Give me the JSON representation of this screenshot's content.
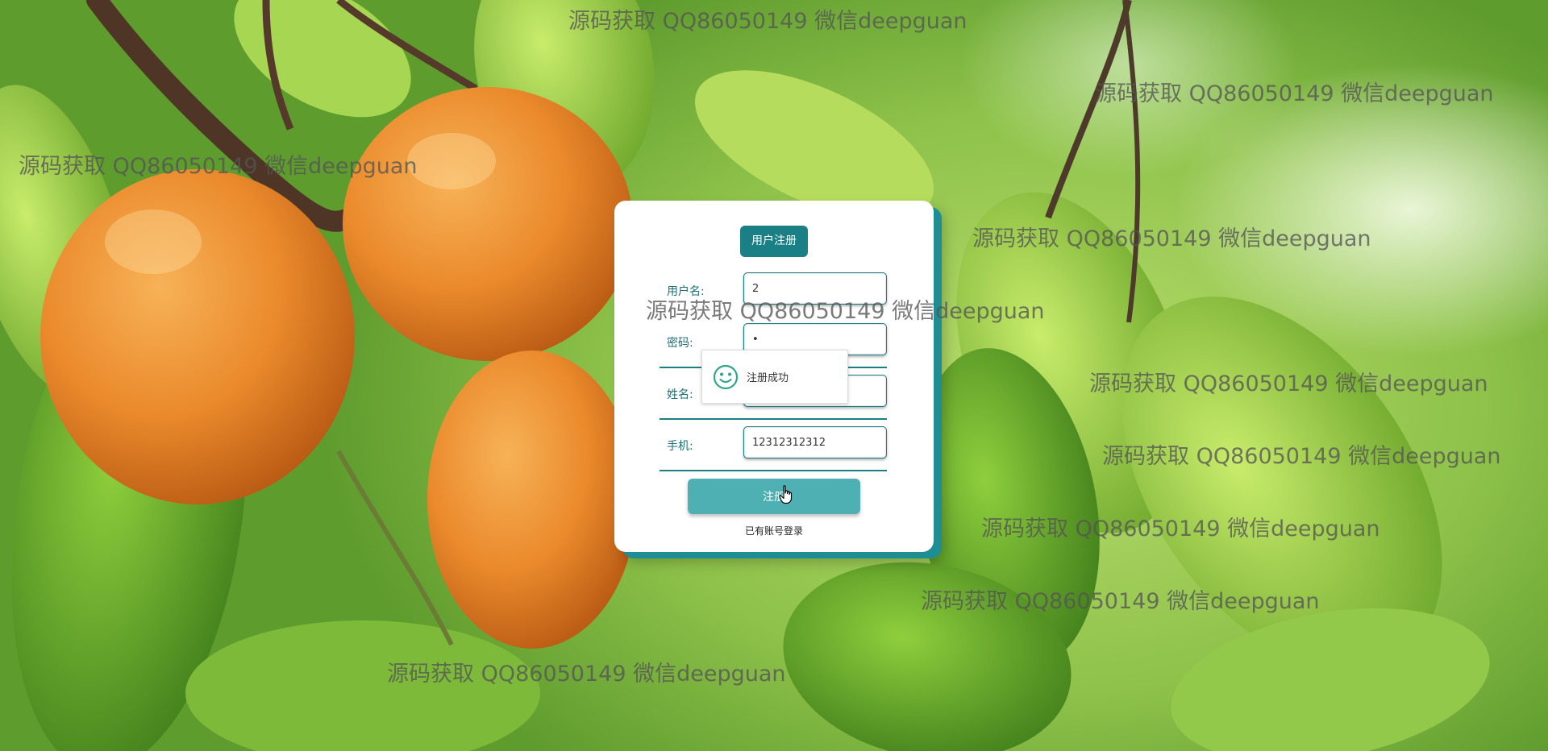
{
  "form": {
    "title": "用户注册",
    "fields": [
      {
        "label": "用户名:",
        "value": "2"
      },
      {
        "label": "密码:",
        "value": "•"
      },
      {
        "label": "姓名:",
        "value": ""
      },
      {
        "label": "手机:",
        "value": "12312312312"
      }
    ],
    "submit_label": "注册",
    "login_link": "已有账号登录"
  },
  "toast": {
    "message": "注册成功",
    "icon": "smiley-icon"
  },
  "watermark_text": "源码获取 QQ86050149 微信deepguan",
  "colors": {
    "accent": "#1b7f86",
    "button": "#4fb0b4",
    "toast_icon": "#2fa886"
  }
}
